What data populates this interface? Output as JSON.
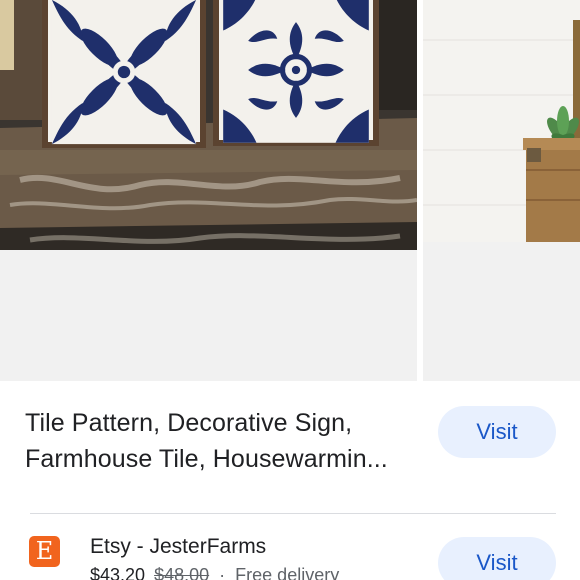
{
  "gallery": {
    "main_image": "decorative-tile-signs-photo",
    "next_image": "succulent-wooden-box-photo"
  },
  "product": {
    "title_line_1": "Tile Pattern, Decorative Sign,",
    "title_line_2": "Farmhouse Tile, Housewarmin...",
    "visit_label": "Visit"
  },
  "seller": {
    "logo_letter": "E",
    "name": "Etsy - JesterFarms",
    "price": "$43.20",
    "old_price": "$48.00",
    "separator": "·",
    "delivery": "Free delivery",
    "visit_label": "Visit"
  },
  "colors": {
    "visit_bg": "#e8f0fe",
    "visit_text": "#1a57c8",
    "etsy_orange": "#f1641e",
    "tile_navy": "#1f2f6b"
  }
}
